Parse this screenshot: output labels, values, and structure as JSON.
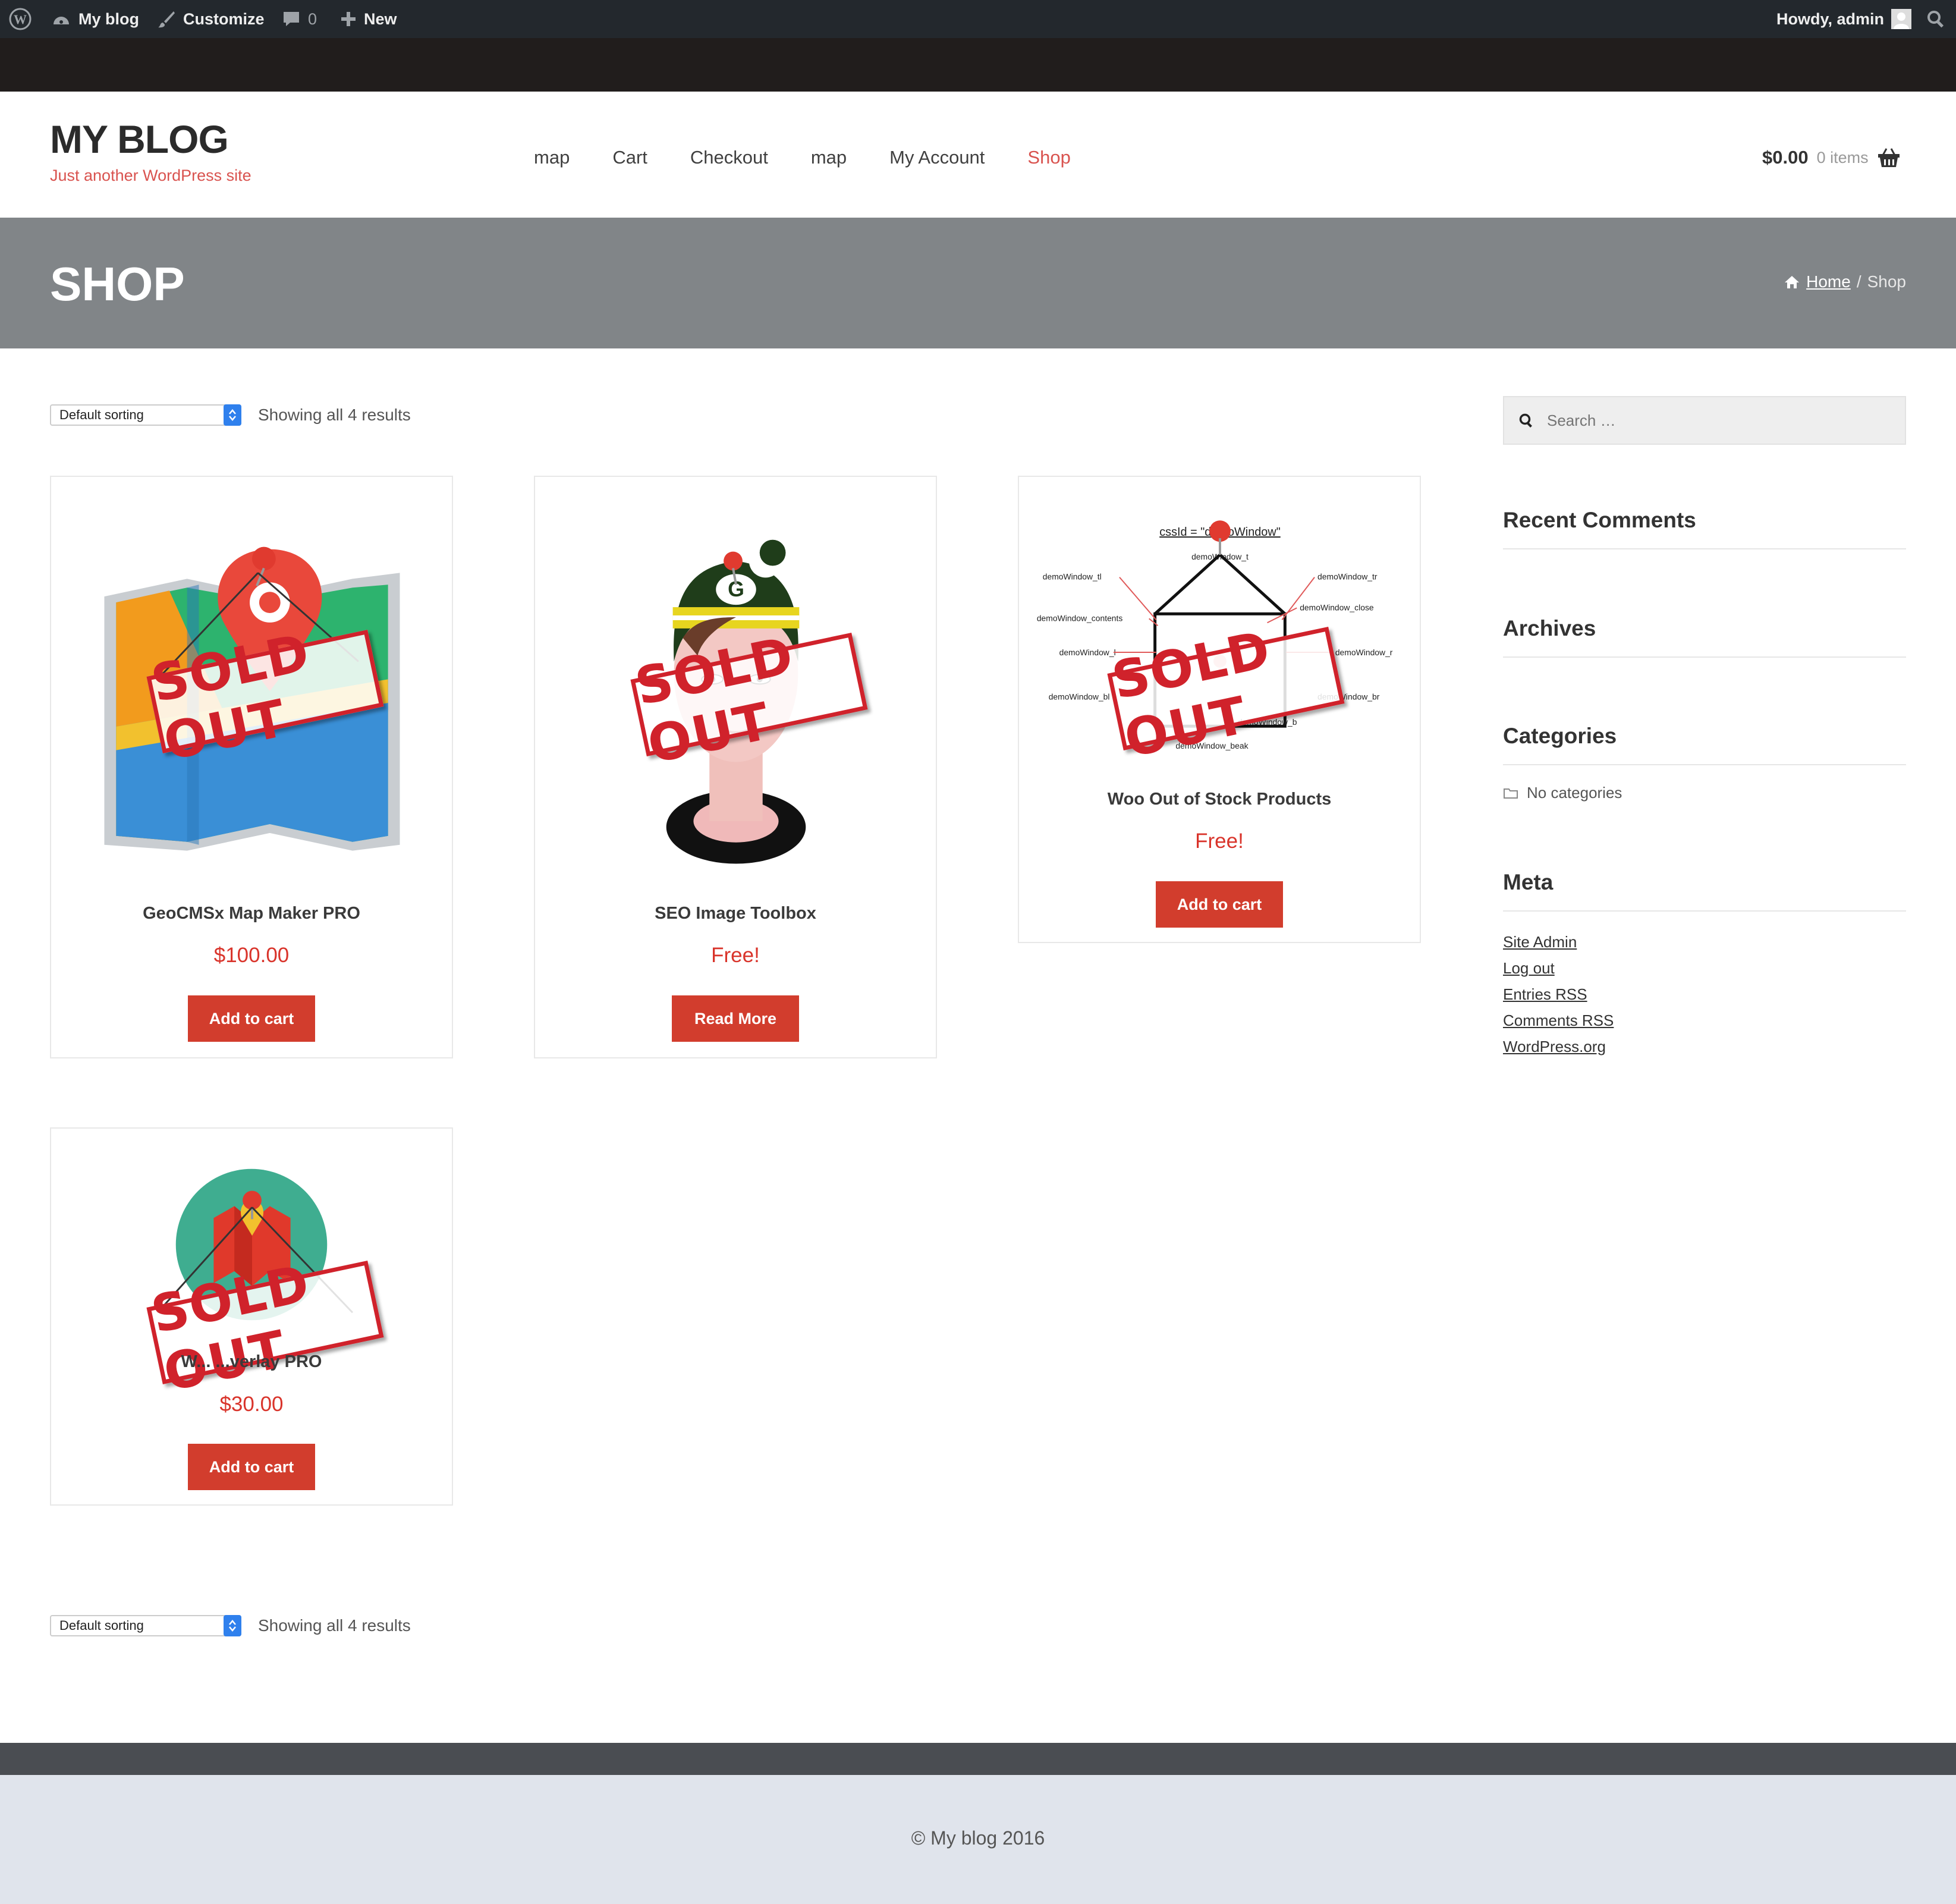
{
  "admin_bar": {
    "wp_icon": "wordpress-logo-icon",
    "site_name": "My blog",
    "customize": "Customize",
    "comments_count": "0",
    "new_label": "New",
    "howdy": "Howdy, admin"
  },
  "header": {
    "site_title": "MY BLOG",
    "tagline": "Just another WordPress site",
    "nav": [
      "map",
      "Cart",
      "Checkout",
      "map",
      "My Account",
      "Shop"
    ],
    "cart_amount": "$0.00",
    "cart_count": "0 items"
  },
  "banner": {
    "title": "SHOP",
    "breadcrumb_home": "Home",
    "breadcrumb_sep": "/",
    "breadcrumb_current": "Shop"
  },
  "ordering": {
    "sort_value": "Default sorting",
    "result_count": "Showing all 4 results"
  },
  "products": [
    {
      "title": "GeoCMSx Map Maker PRO",
      "price": "$100.00",
      "button": "Add to cart",
      "badge": "SOLD OUT"
    },
    {
      "title": "SEO Image Toolbox",
      "price": "Free!",
      "button": "Read More",
      "badge": "SOLD OUT"
    },
    {
      "title": "Woo Out of Stock Products",
      "price": "Free!",
      "button": "Add to cart",
      "badge": "SOLD OUT"
    },
    {
      "title": "W... ...verlay PRO",
      "price": "$30.00",
      "button": "Add to cart",
      "badge": "SOLD OUT"
    }
  ],
  "diagram_labels": {
    "cssid": "cssId = \"demoWindow\"",
    "tl": "demoWindow_tl",
    "tr": "demoWindow_tr",
    "close": "demoWindow_close",
    "contents": "demoWindow_contents",
    "l": "demoWindow_l",
    "r": "demoWindow_r",
    "bl": "demoWindow_bl",
    "br": "demoWindow_br",
    "b": "demoWindow_b",
    "beak": "demoWindow_beak"
  },
  "sidebar": {
    "search_placeholder": "Search …",
    "recent_comments": "Recent Comments",
    "archives": "Archives",
    "categories": "Categories",
    "no_categories": "No categories",
    "meta": "Meta",
    "meta_links": [
      "Site Admin",
      "Log out",
      "Entries RSS",
      "Comments RSS",
      "WordPress.org"
    ]
  },
  "footer": {
    "copyright": "© My blog 2016"
  },
  "colors": {
    "accent": "#d9534f",
    "button": "#d23d2d",
    "price": "#d9342b",
    "admin_bar": "#23282d",
    "banner": "#818588"
  }
}
